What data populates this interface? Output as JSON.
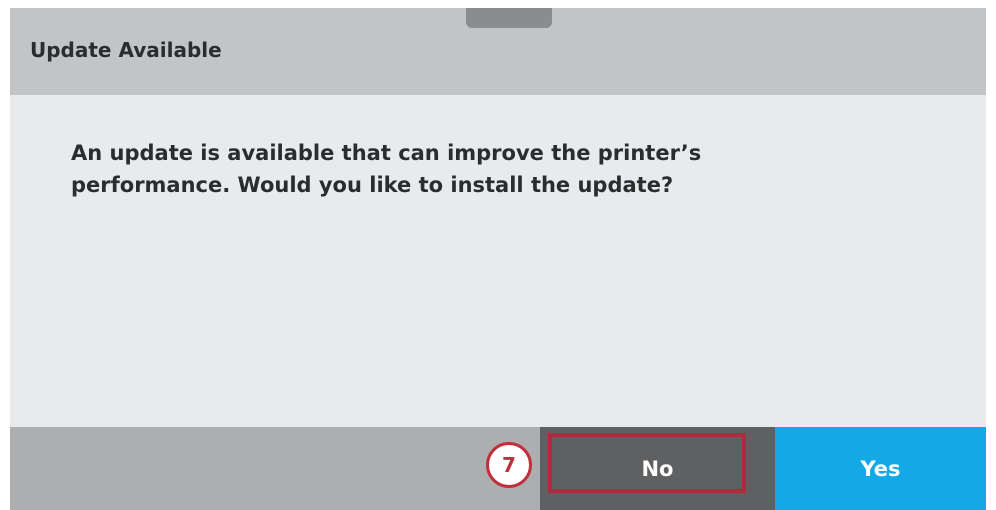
{
  "dialog": {
    "title": "Update Available",
    "message": "An update is available that can improve the printer’s performance. Would you like to install the update?"
  },
  "buttons": {
    "no_label": "No",
    "yes_label": "Yes"
  },
  "annotation": {
    "callout_number": "7"
  },
  "colors": {
    "title_bar": "#c2c4c6",
    "body": "#e9eaeb",
    "footer": "#acaeb0",
    "no_button": "#5e6062",
    "yes_button": "#14a9e6",
    "highlight": "#b3283c"
  }
}
